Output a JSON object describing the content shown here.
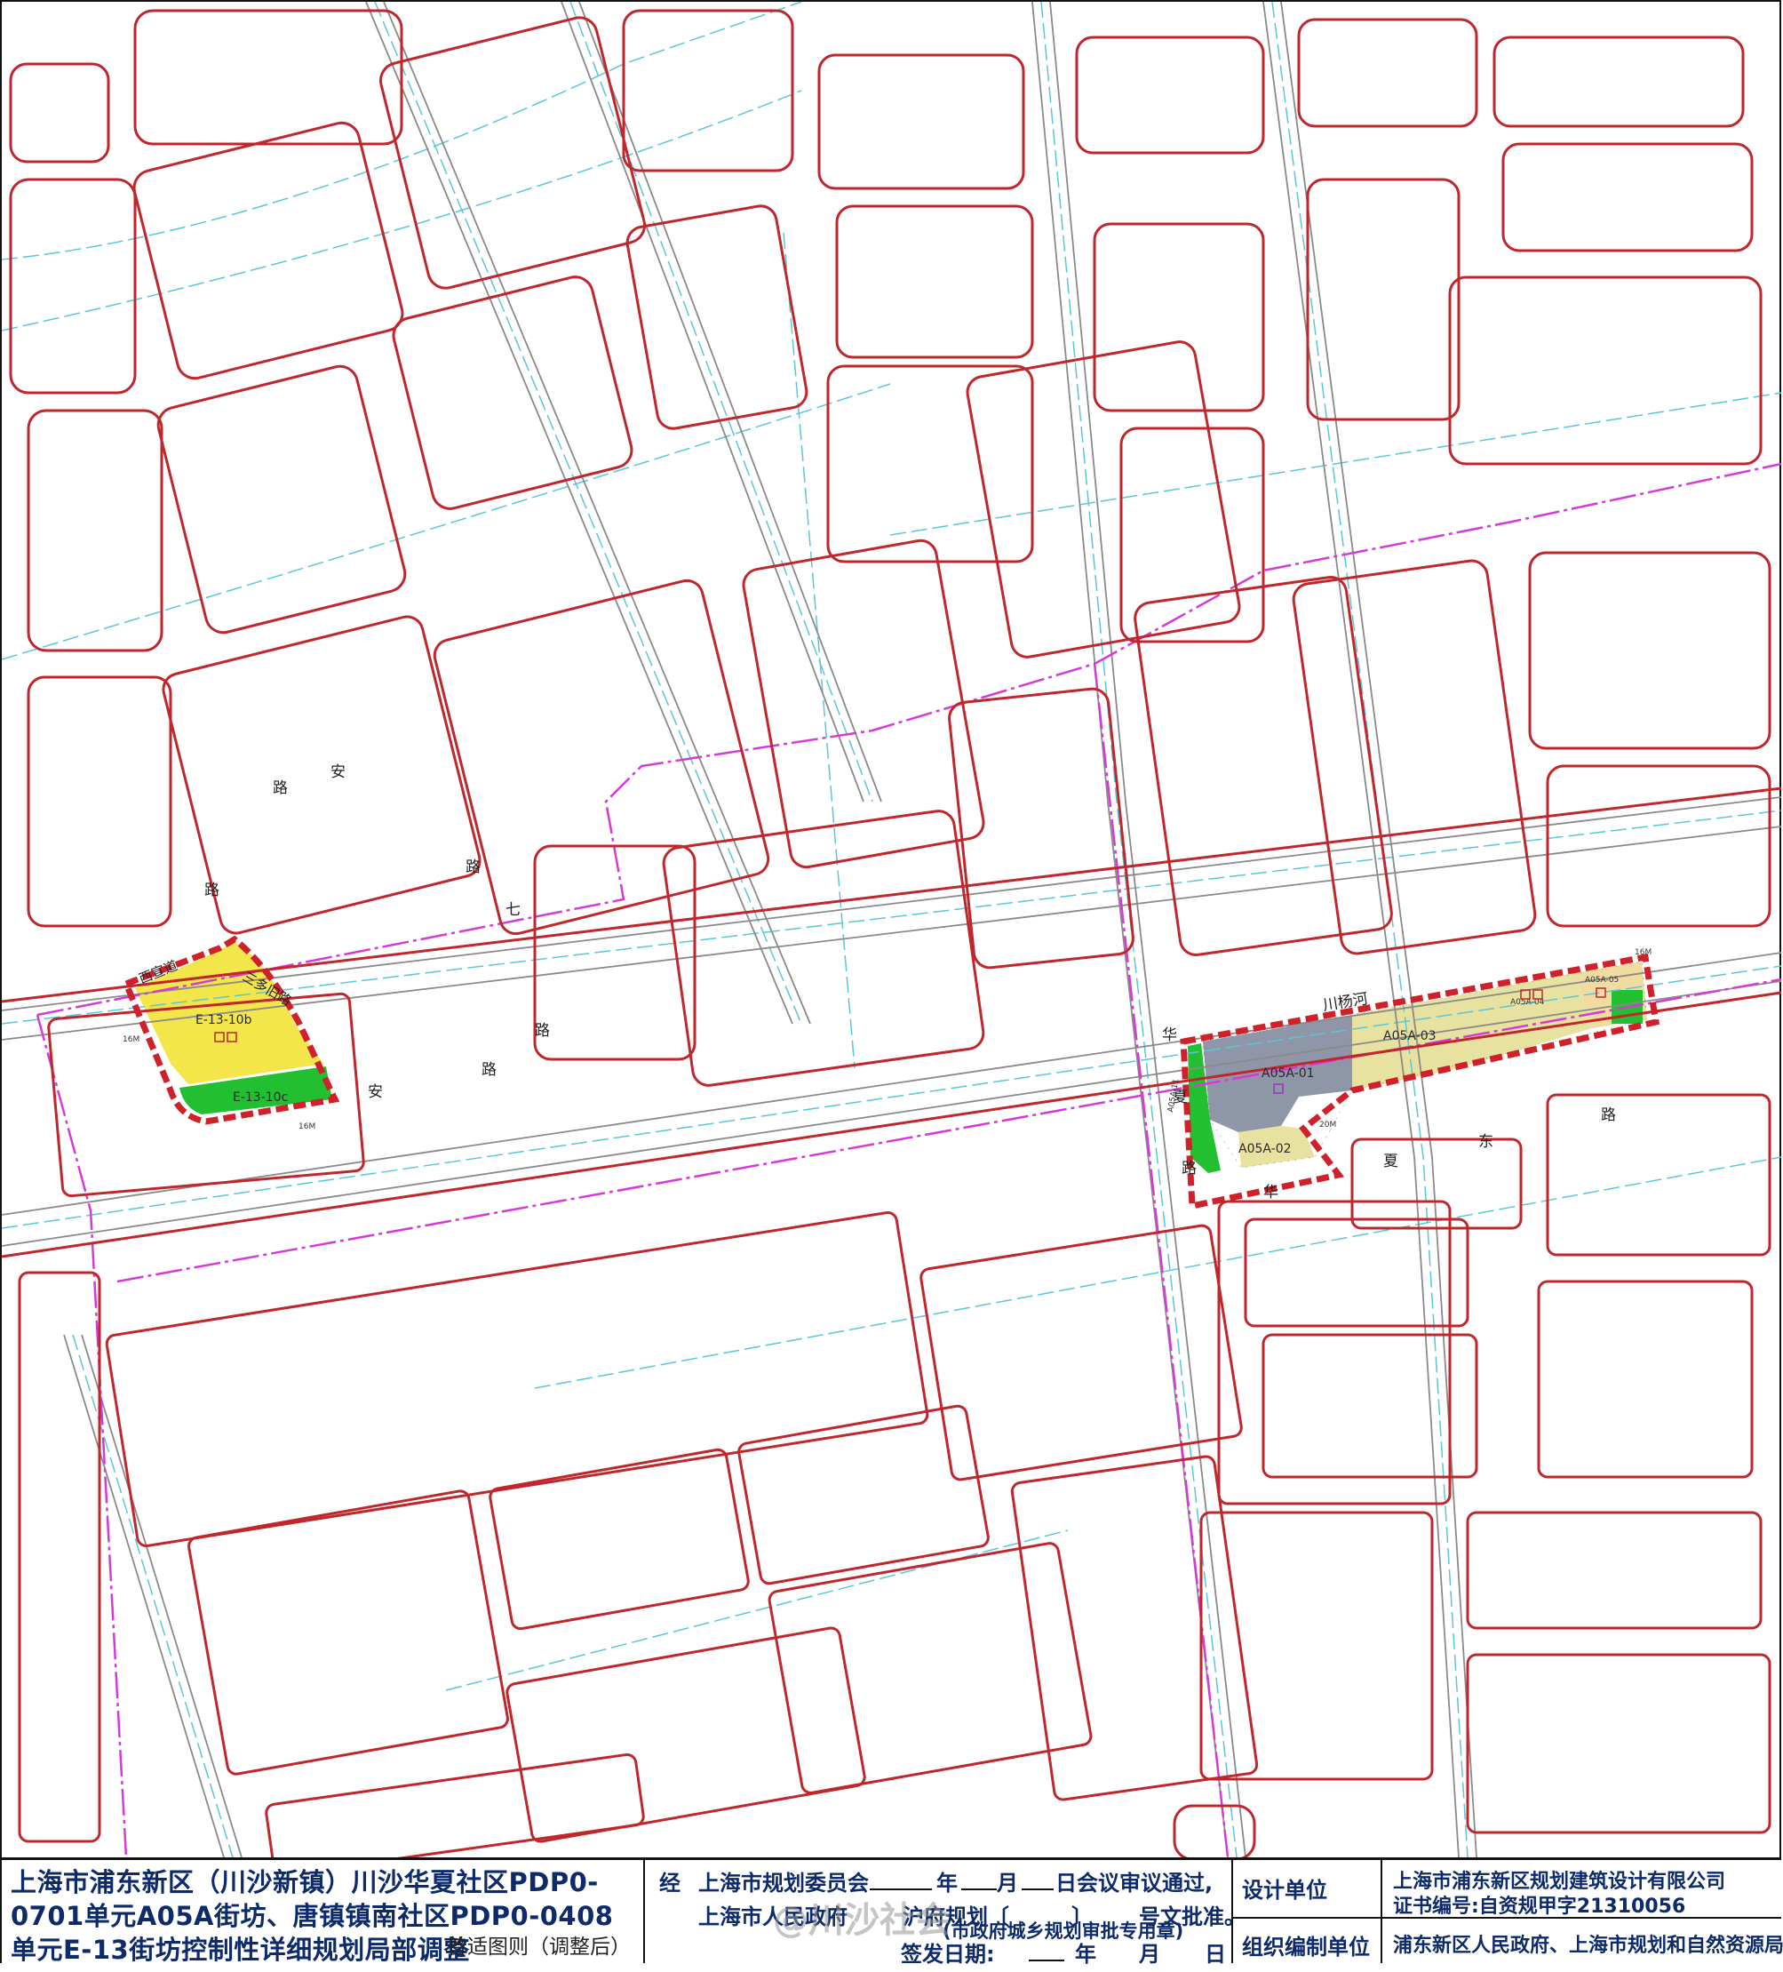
{
  "map": {
    "colors": {
      "road_red_line": "#c0272d",
      "road_center_cyan": "#58c8d8",
      "road_edge_gray": "#8a8a8a",
      "boundary_magenta": "#d63ad6",
      "plan_boundary": "#d0202a",
      "residential_yellow": "#f2e64a",
      "green_space": "#22c030",
      "commercial_gray": "#8f96a8",
      "mixed_beige": "#e8e2a0",
      "light_beige": "#f0dca0"
    },
    "road_labels": {
      "xichuan_road_a": "路",
      "xichuan_road_b": "路",
      "an_road": "安",
      "an_road2": "路",
      "qi_road_a": "七",
      "qi_road_b": "路",
      "an_road3": "路",
      "an_road4": "安",
      "chuanyang_river": "川杨河",
      "hua_road_a": "华",
      "hua_road_b": "夏",
      "hua_road_c": "路",
      "xiadong_road_a": "夏",
      "xiadong_road_b": "东",
      "xiadong_road_c": "路",
      "hua_road_d": "华",
      "xisui_road": "西宣道",
      "sanyuan_road": "三多旧路"
    },
    "parcels": {
      "e13_10b": "E-13-10b",
      "e13_10c": "E-13-10c",
      "a05a_01": "A05A-01",
      "a05a_02": "A05A-02",
      "a05a_03": "A05A-03",
      "a05a_04": "A05A-04",
      "a05a_05": "A05A-05",
      "a05a_11": "A05A-11"
    },
    "small_labels": {
      "w16_a": "16M",
      "w16_b": "16M",
      "w16_c": "16M",
      "w20": "20M"
    }
  },
  "titleblock": {
    "title": "上海市浦东新区（川沙新镇）川沙华夏社区PDP0-0701单元A05A街坊、唐镇镇南社区PDP0-0408单元E-13街坊控制性详细规划局部调整",
    "subtitle": "普适图则（调整后）",
    "approval_jing": "经",
    "approval_line1_a": "上海市规划委员会",
    "approval_line1_b": "年",
    "approval_line1_c": "月",
    "approval_line1_d": "日会议审议通过,",
    "approval_line2_a": "上海市人民政府",
    "approval_line2_b": "沪府规划〔",
    "approval_line2_c": "〕",
    "approval_line2_d": "号文批准。",
    "seal": "(市政府城乡规划审批专用章)",
    "sign_date_a": "签发日期:",
    "sign_date_b": "年",
    "sign_date_c": "月",
    "sign_date_d": "日",
    "design_unit_label": "设计单位",
    "design_unit_value": "上海市浦东新区规划建筑设计有限公司",
    "cert_value": "证书编号:自资规甲字21310056",
    "org_unit_label": "组织编制单位",
    "org_unit_value": "浦东新区人民政府、上海市规划和自然资源局"
  },
  "watermark": "@川沙社会"
}
